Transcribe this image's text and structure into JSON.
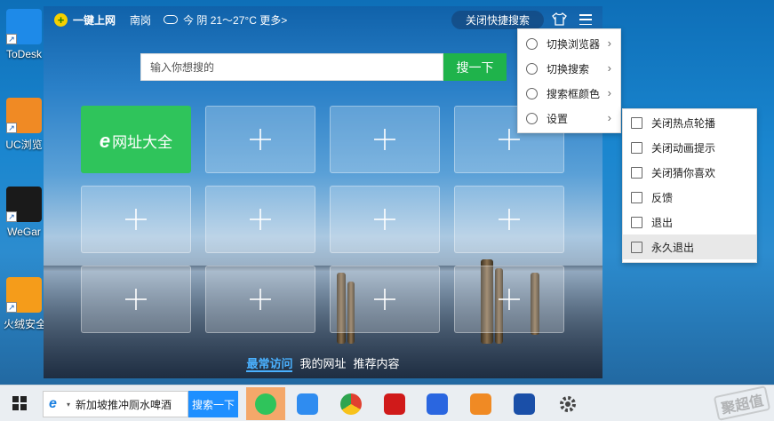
{
  "desktop": {
    "icons": [
      {
        "label": "ToDesk",
        "icon": "todesk-icon",
        "color": "#1e8ae8"
      },
      {
        "label": "UC浏览",
        "icon": "uc-browser-icon",
        "color": "#f08a24"
      },
      {
        "label": "WeGar",
        "icon": "wegame-icon",
        "color": "#1a1a1a"
      },
      {
        "label": "火绒安全",
        "icon": "huorong-icon",
        "color": "#f59c1a"
      }
    ]
  },
  "window": {
    "brand": "一键上网",
    "city": "南岗",
    "weather": "今 阴 21～27°C 更多>",
    "close_quick_search": "关闭快捷搜索",
    "search": {
      "placeholder": "输入你想搜的",
      "button": "搜一下"
    },
    "featured_tile": {
      "e": "e",
      "label": "网址大全"
    },
    "bottom_tabs": [
      "最常访问",
      "我的网址",
      "推荐内容"
    ]
  },
  "menu_main": {
    "items": [
      {
        "label": "切换浏览器",
        "icon": "browser-switch-icon"
      },
      {
        "label": "切换搜索",
        "icon": "search-switch-icon"
      },
      {
        "label": "搜索框颜色",
        "icon": "color-drop-icon"
      },
      {
        "label": "设置",
        "icon": "gear-icon"
      }
    ]
  },
  "menu_settings": {
    "items": [
      {
        "label": "关闭热点轮播",
        "icon": "carousel-off-icon"
      },
      {
        "label": "关闭动画提示",
        "icon": "animation-off-icon"
      },
      {
        "label": "关闭猜你喜欢",
        "icon": "recommend-off-icon"
      },
      {
        "label": "反馈",
        "icon": "feedback-icon"
      },
      {
        "label": "退出",
        "icon": "exit-icon"
      },
      {
        "label": "永久退出",
        "icon": "permanent-exit-icon"
      }
    ]
  },
  "taskbar": {
    "search_text": "新加坡推冲厕水啤酒",
    "search_button": "搜索一下",
    "apps": [
      {
        "name": "ie-browser-icon",
        "color": "#2fc45b"
      },
      {
        "name": "feishu-icon",
        "color": "#2f8cf0"
      },
      {
        "name": "chrome-icon",
        "color": "#e04030"
      },
      {
        "name": "huawei-app-icon",
        "color": "#d01a1a"
      },
      {
        "name": "baidu-netdisk-icon",
        "color": "#2a66e0"
      },
      {
        "name": "uc-browser-icon",
        "color": "#f08a24"
      },
      {
        "name": "network-app-icon",
        "color": "#1a4fa8"
      },
      {
        "name": "settings-gear-icon",
        "color": "#444444"
      }
    ],
    "watermark": "聚超值"
  }
}
